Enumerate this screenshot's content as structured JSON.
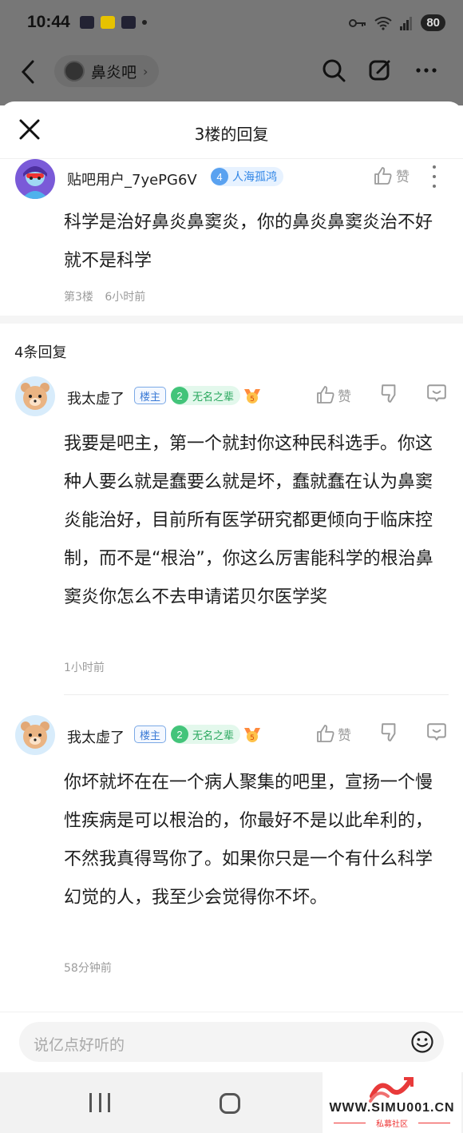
{
  "status_bar": {
    "time": "10:44",
    "battery": "80"
  },
  "bg_nav": {
    "forum_name": "鼻炎吧",
    "forum_chevron": "›"
  },
  "sheet": {
    "title": "3楼的回复",
    "main_post": {
      "username": "贴吧用户_7yePG6V",
      "level": "4",
      "level_title": "人海孤鸿",
      "like_label": "赞",
      "body": "科学是治好鼻炎鼻窦炎，你的鼻炎鼻窦炎治不好就不是科学",
      "floor": "第3楼",
      "time": "6小时前"
    },
    "reply_count": "4条回复",
    "replies": [
      {
        "username": "我太虚了",
        "owner_tag": "楼主",
        "level": "2",
        "level_title": "无名之辈",
        "like_label": "赞",
        "body": "我要是吧主，第一个就封你这种民科选手。你这种人要么就是蠢要么就是坏，蠢就蠢在认为鼻窦炎能治好，目前所有医学研究都更倾向于临床控制，而不是“根治”，你这么厉害能科学的根治鼻窦炎你怎么不去申请诺贝尔医学奖",
        "time": "1小时前"
      },
      {
        "username": "我太虚了",
        "owner_tag": "楼主",
        "level": "2",
        "level_title": "无名之辈",
        "like_label": "赞",
        "body": "你坏就坏在在一个病人聚集的吧里，宣扬一个慢性疾病是可以根治的，你最好不是以此牟利的，不然我真得骂你了。如果你只是一个有什么科学幻觉的人，我至少会觉得你不坏。",
        "time": "58分钟前"
      }
    ]
  },
  "input": {
    "placeholder": "说亿点好听的"
  },
  "watermark": {
    "url": "WWW.SIMU001.CN",
    "sub": "私募社区"
  },
  "colors": {
    "accent_blue": "#2f85e6",
    "level_green": "#26a65b",
    "dim_overlay": "#777777"
  }
}
